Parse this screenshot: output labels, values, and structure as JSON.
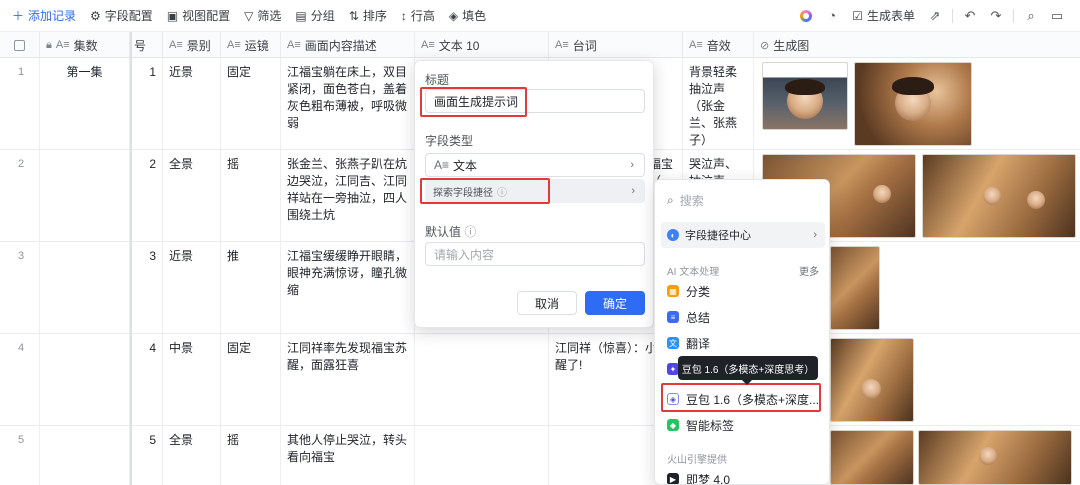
{
  "toolbar": {
    "add_record": "添加记录",
    "field_config": "字段配置",
    "view_config": "视图配置",
    "filter": "筛选",
    "group": "分组",
    "sort": "排序",
    "row_height": "行高",
    "fill_color": "填色",
    "generate_form": "生成表单"
  },
  "columns": {
    "episode": "集数",
    "no": "号",
    "shot": "景别",
    "camera": "运镜",
    "description": "画面内容描述",
    "text10": "文本 10",
    "lines": "台词",
    "sound": "音效",
    "image": "生成图"
  },
  "rows": [
    {
      "n": "1",
      "episode": "第一集",
      "no": "1",
      "shot": "近景",
      "camera": "固定",
      "description": "江福宝躺在床上，双目紧闭，面色苍白，盖着灰色粗布薄被，呼吸微弱",
      "lines": "",
      "sound": "背景轻柔抽泣声（张金兰、张燕子）"
    },
    {
      "n": "2",
      "episode": "",
      "no": "2",
      "shot": "全景",
      "camera": "摇",
      "description": "张金兰、张燕子趴在炕边哭泣，江同吉、江同祥站在一旁抽泣，四人围绕土炕",
      "lines": "福宝（",
      "sound": "哭泣声、抽泣声"
    },
    {
      "n": "3",
      "episode": "",
      "no": "3",
      "shot": "近景",
      "camera": "推",
      "description": "江福宝缓缓睁开眼睛，眼神充满惊讶，瞳孔微缩",
      "lines": "",
      "sound": ""
    },
    {
      "n": "4",
      "episode": "",
      "no": "4",
      "shot": "中景",
      "camera": "固定",
      "description": "江同祥率先发现福宝苏醒，面露狂喜",
      "lines": "江同祥（惊喜）：小妹醒了!",
      "sound": ""
    },
    {
      "n": "5",
      "episode": "",
      "no": "5",
      "shot": "全景",
      "camera": "摇",
      "description": "其他人停止哭泣，转头看向福宝",
      "lines": "",
      "sound": ""
    }
  ],
  "dialog": {
    "title_label": "标题",
    "title_value": "画面生成提示词",
    "type_label": "字段类型",
    "type_value": "文本",
    "shortcut_label": "探索字段捷径",
    "default_label": "默认值",
    "default_placeholder": "请输入内容",
    "cancel": "取消",
    "ok": "确定"
  },
  "dropdown": {
    "search_placeholder": "搜索",
    "center": "字段捷径中心",
    "section_ai": "AI 文本处理",
    "more": "更多",
    "items": [
      "分类",
      "总结",
      "翻译",
      "",
      "豆包 1.6（多模态+深度...",
      "智能标签"
    ],
    "section_volc": "火山引擎提供",
    "volc_item": "即梦 4.0"
  },
  "tooltip": "豆包 1.6（多模态+深度思考）",
  "colors": {
    "accent": "#2e6cf6",
    "highlight": "#e03a3a"
  }
}
